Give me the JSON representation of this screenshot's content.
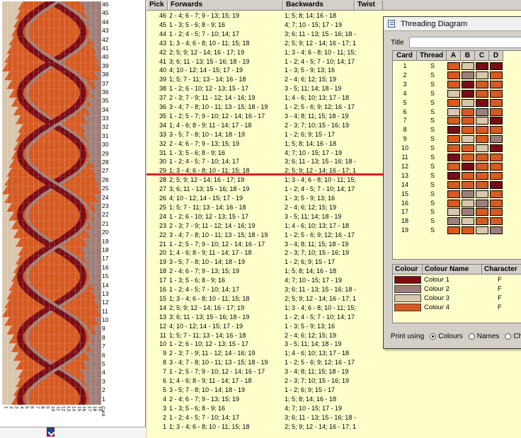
{
  "pattern": {
    "row_numbers": [
      "46",
      "45",
      "44",
      "43",
      "42",
      "41",
      "40",
      "39",
      "38",
      "37",
      "36",
      "35",
      "34",
      "33",
      "32",
      "31",
      "30",
      "29",
      "28",
      "27",
      "26",
      "25",
      "24",
      "23",
      "22",
      "21",
      "20",
      "19",
      "18",
      "17",
      "16",
      "15",
      "14",
      "13",
      "12",
      "11",
      "10",
      "9",
      "8",
      "7",
      "6",
      "5",
      "4",
      "3",
      "2",
      "1"
    ],
    "card_labels": [
      "1",
      "2",
      "3",
      "4",
      "5",
      "6",
      "7",
      "8",
      "9",
      "10",
      "11",
      "12",
      "13",
      "14",
      "15",
      "16",
      "17",
      "18",
      "19"
    ],
    "card_axis_label": "Card",
    "colors": {
      "orange": "#d65a22",
      "dark_red": "#7a0c16",
      "beige": "#d8c7ad",
      "mauve": "#9d7f79",
      "grid_line": "#ffffff"
    }
  },
  "table": {
    "headers": {
      "pick": "Pick",
      "forwards": "Forwards",
      "backwards": "Backwards",
      "twist": "Twist"
    },
    "rows": [
      {
        "pick": "46",
        "fw": "2 - 4; 6 - 7; 9 - 13; 15; 19",
        "bw": "1; 5; 8; 14; 16 - 18"
      },
      {
        "pick": "45",
        "fw": "1 - 3; 5 - 6; 8 - 9; 16",
        "bw": "4; 7; 10 - 15; 17 - 19"
      },
      {
        "pick": "44",
        "fw": "1 - 2; 4 - 5; 7 - 10; 14; 17",
        "bw": "3; 6; 11 - 13; 15 - 16; 18 -"
      },
      {
        "pick": "43",
        "fw": "1; 3 - 4; 6 - 8; 10 - 11; 15; 18",
        "bw": "2; 5; 9; 12 - 14; 16 - 17; 1"
      },
      {
        "pick": "42",
        "fw": "2; 5; 9; 12 - 14; 16 - 17; 19",
        "bw": "1; 3 - 4; 6 - 8; 10 - 11; 15;"
      },
      {
        "pick": "41",
        "fw": "3; 6; 11 - 13; 15 - 16; 18 - 19",
        "bw": "1 - 2; 4 - 5; 7 - 10; 14; 17"
      },
      {
        "pick": "40",
        "fw": "4; 10 - 12; 14 - 15; 17 - 19",
        "bw": "1 - 3; 5 - 9; 13; 16"
      },
      {
        "pick": "39",
        "fw": "1; 5; 7 - 11; 13 - 14; 16 - 18",
        "bw": "2 - 4; 6; 12; 15; 19"
      },
      {
        "pick": "38",
        "fw": "1 - 2; 6 - 10; 12 - 13; 15 - 17",
        "bw": "3 - 5; 11; 14; 18 - 19"
      },
      {
        "pick": "37",
        "fw": "2 - 3; 7 - 9; 11 - 12; 14 - 16; 19",
        "bw": "1; 4 - 6; 10; 13; 17 - 18"
      },
      {
        "pick": "36",
        "fw": "3 - 4; 7 - 8; 10 - 11; 13 - 15; 18 - 19",
        "bw": "1 - 2; 5 - 6; 9; 12; 16 - 17"
      },
      {
        "pick": "35",
        "fw": "1 - 2; 5 - 7; 9 - 10; 12 - 14; 16 - 17",
        "bw": "3 - 4; 8; 11; 15; 18 - 19"
      },
      {
        "pick": "34",
        "fw": "1; 4 - 6; 8 - 9; 11 - 14; 17 - 18",
        "bw": "2 - 3; 7; 10; 15 - 16; 19"
      },
      {
        "pick": "33",
        "fw": "3 - 5; 7 - 8; 10 - 14; 18 - 19",
        "bw": "1 - 2; 6; 9; 15 - 17"
      },
      {
        "pick": "32",
        "fw": "2 - 4; 6 - 7; 9 - 13; 15; 19",
        "bw": "1; 5; 8; 14; 16 - 18"
      },
      {
        "pick": "31",
        "fw": "1 - 3; 5 - 6; 8 - 9; 16",
        "bw": "4; 7; 10 - 15; 17 - 19"
      },
      {
        "pick": "30",
        "fw": "1 - 2; 4 - 5; 7 - 10; 14; 17",
        "bw": "3; 6; 11 - 13; 15 - 16; 18 -"
      },
      {
        "pick": "29",
        "fw": "1; 3 - 4; 6 - 8; 10 - 11; 15; 18",
        "bw": "2; 5; 9; 12 - 14; 16 - 17; 1"
      },
      {
        "pick": "28",
        "fw": "2; 5; 9; 12 - 14; 16 - 17; 19",
        "bw": "1; 3 - 4; 6 - 8; 10 - 11; 15;"
      },
      {
        "pick": "27",
        "fw": "3; 6; 11 - 13; 15 - 16; 18 - 19",
        "bw": "1 - 2; 4 - 5; 7 - 10; 14; 17"
      },
      {
        "pick": "26",
        "fw": "4; 10 - 12; 14 - 15; 17 - 19",
        "bw": "1 - 3; 5 - 9; 13; 16"
      },
      {
        "pick": "25",
        "fw": "1; 5; 7 - 11; 13 - 14; 16 - 18",
        "bw": "2 - 4; 6; 12; 15; 19"
      },
      {
        "pick": "24",
        "fw": "1 - 2; 6 - 10; 12 - 13; 15 - 17",
        "bw": "3 - 5; 11; 14; 18 - 19"
      },
      {
        "pick": "23",
        "fw": "2 - 3; 7 - 9; 11 - 12; 14 - 16; 19",
        "bw": "1; 4 - 6; 10; 13; 17 - 18"
      },
      {
        "pick": "22",
        "fw": "3 - 4; 7 - 8; 10 - 11; 13 - 15; 18 - 19",
        "bw": "1 - 2; 5 - 6; 9; 12; 16 - 17"
      },
      {
        "pick": "21",
        "fw": "1 - 2; 5 - 7; 9 - 10; 12 - 14; 16 - 17",
        "bw": "3 - 4; 8; 11; 15; 18 - 19"
      },
      {
        "pick": "20",
        "fw": "1; 4 - 6; 8 - 9; 11 - 14; 17 - 18",
        "bw": "2 - 3; 7; 10; 15 - 16; 19"
      },
      {
        "pick": "19",
        "fw": "3 - 5; 7 - 8; 10 - 14; 18 - 19",
        "bw": "1 - 2; 6; 9; 15 - 17"
      },
      {
        "pick": "18",
        "fw": "2 - 4; 6 - 7; 9 - 13; 15; 19",
        "bw": "1; 5; 8; 14; 16 - 18"
      },
      {
        "pick": "17",
        "fw": "1 - 3; 5 - 6; 8 - 9; 16",
        "bw": "4; 7; 10 - 15; 17 - 19"
      },
      {
        "pick": "16",
        "fw": "1 - 2; 4 - 5; 7 - 10; 14; 17",
        "bw": "3; 6; 11 - 13; 15 - 16; 18 -"
      },
      {
        "pick": "15",
        "fw": "1; 3 - 4; 6 - 8; 10 - 11; 15; 18",
        "bw": "2; 5; 9; 12 - 14; 16 - 17; 1"
      },
      {
        "pick": "14",
        "fw": "2; 5; 9; 12 - 14; 16 - 17; 19",
        "bw": "1; 3 - 4; 6 - 8; 10 - 11; 15;"
      },
      {
        "pick": "13",
        "fw": "3; 6; 11 - 13; 15 - 16; 18 - 19",
        "bw": "1 - 2; 4 - 5; 7 - 10; 14; 17"
      },
      {
        "pick": "12",
        "fw": "4; 10 - 12; 14 - 15; 17 - 19",
        "bw": "1 - 3; 5 - 9; 13; 16"
      },
      {
        "pick": "11",
        "fw": "1; 5; 7 - 11; 13 - 14; 16 - 18",
        "bw": "2 - 4; 6; 12; 15; 19"
      },
      {
        "pick": "10",
        "fw": "1 - 2; 6 - 10; 12 - 13; 15 - 17",
        "bw": "3 - 5; 11; 14; 18 - 19"
      },
      {
        "pick": "9",
        "fw": "2 - 3; 7 - 9; 11 - 12; 14 - 16; 19",
        "bw": "1; 4 - 6; 10; 13; 17 - 18"
      },
      {
        "pick": "8",
        "fw": "3 - 4; 7 - 8; 10 - 11; 13 - 15; 18 - 19",
        "bw": "1 - 2; 5 - 6; 9; 12; 16 - 17"
      },
      {
        "pick": "7",
        "fw": "1 - 2; 5 - 7; 9 - 10; 12 - 14; 16 - 17",
        "bw": "3 - 4; 8; 11; 15; 18 - 19"
      },
      {
        "pick": "6",
        "fw": "1; 4 - 6; 8 - 9; 11 - 14; 17 - 18",
        "bw": "2 - 3; 7; 10; 15 - 16; 19"
      },
      {
        "pick": "5",
        "fw": "3 - 5; 7 - 8; 10 - 14; 18 - 19",
        "bw": "1 - 2; 6; 9; 15 - 17"
      },
      {
        "pick": "4",
        "fw": "2 - 4; 6 - 7; 9 - 13; 15; 19",
        "bw": "1; 5; 8; 14; 16 - 18"
      },
      {
        "pick": "3",
        "fw": "1 - 3; 5 - 6; 8 - 9; 16",
        "bw": "4; 7; 10 - 15; 17 - 19"
      },
      {
        "pick": "2",
        "fw": "1 - 2; 4 - 5; 7 - 10; 14; 17",
        "bw": "3; 6; 11 - 13; 15 - 16; 18 -"
      },
      {
        "pick": "1",
        "fw": "1; 3 - 4; 6 - 8; 10 - 11; 15; 18",
        "bw": "2; 5; 9; 12 - 14; 16 - 17; 1"
      }
    ]
  },
  "threading": {
    "window_title": "Threading Diagram",
    "title_label": "Title",
    "title_value": "",
    "headers": {
      "card": "Card",
      "thread": "Thread",
      "a": "A",
      "b": "B",
      "c": "C",
      "d": "D"
    },
    "swatch_colors": {
      "1": "#7a0c16",
      "2": "#9d7f79",
      "3": "#d8c7ad",
      "4": "#d65a22"
    },
    "cards": [
      {
        "card": "1",
        "thread": "S",
        "holes": [
          4,
          3,
          1,
          1
        ]
      },
      {
        "card": "2",
        "thread": "S",
        "holes": [
          4,
          2,
          3,
          4
        ]
      },
      {
        "card": "3",
        "thread": "S",
        "holes": [
          4,
          1,
          4,
          4
        ]
      },
      {
        "card": "4",
        "thread": "S",
        "holes": [
          3,
          1,
          4,
          4
        ]
      },
      {
        "card": "5",
        "thread": "S",
        "holes": [
          4,
          3,
          1,
          4
        ]
      },
      {
        "card": "6",
        "thread": "S",
        "holes": [
          3,
          4,
          2,
          4
        ]
      },
      {
        "card": "7",
        "thread": "S",
        "holes": [
          4,
          4,
          3,
          1
        ]
      },
      {
        "card": "8",
        "thread": "S",
        "holes": [
          1,
          4,
          4,
          4
        ]
      },
      {
        "card": "9",
        "thread": "S",
        "holes": [
          4,
          3,
          4,
          2
        ]
      },
      {
        "card": "10",
        "thread": "S",
        "holes": [
          4,
          4,
          3,
          1
        ]
      },
      {
        "card": "11",
        "thread": "S",
        "holes": [
          1,
          4,
          4,
          4
        ]
      },
      {
        "card": "12",
        "thread": "S",
        "holes": [
          4,
          1,
          4,
          4
        ]
      },
      {
        "card": "13",
        "thread": "S",
        "holes": [
          1,
          4,
          4,
          4
        ]
      },
      {
        "card": "14",
        "thread": "S",
        "holes": [
          4,
          4,
          4,
          1
        ]
      },
      {
        "card": "15",
        "thread": "S",
        "holes": [
          4,
          2,
          3,
          4
        ]
      },
      {
        "card": "16",
        "thread": "S",
        "holes": [
          4,
          3,
          2,
          4
        ]
      },
      {
        "card": "17",
        "thread": "S",
        "holes": [
          3,
          2,
          4,
          4
        ]
      },
      {
        "card": "18",
        "thread": "S",
        "holes": [
          2,
          3,
          4,
          4
        ]
      },
      {
        "card": "19",
        "thread": "S",
        "holes": [
          4,
          4,
          3,
          2
        ]
      }
    ],
    "colour_headers": {
      "colour": "Colour",
      "name": "Colour Name",
      "character": "Character"
    },
    "colours": [
      {
        "name": "Colour 1",
        "char": "F",
        "color": "#7a0c16"
      },
      {
        "name": "Colour 2",
        "char": "F",
        "color": "#9d7f79"
      },
      {
        "name": "Colour 3",
        "char": "F",
        "color": "#d8c7ad"
      },
      {
        "name": "Colour 4",
        "char": "F",
        "color": "#d65a22"
      }
    ],
    "print_using_label": "Print using",
    "print_options": [
      "Colours",
      "Names",
      "Cha"
    ],
    "print_selected": "Colours"
  }
}
